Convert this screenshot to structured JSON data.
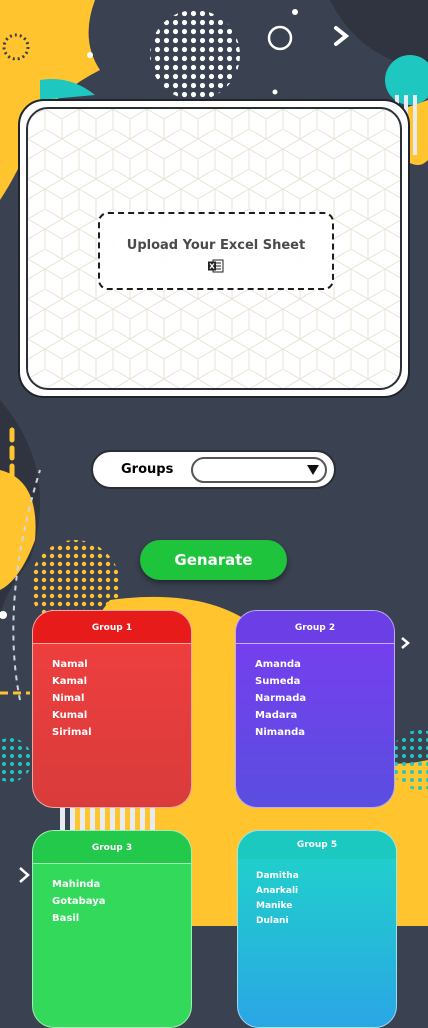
{
  "upload": {
    "label": "Upload Your Excel Sheet",
    "icon": "excel-icon"
  },
  "groups_selector": {
    "label": "Groups",
    "selected": ""
  },
  "generate_button": {
    "label": "Genarate"
  },
  "group_cards": [
    {
      "title": "Group 1",
      "members": [
        "Namal",
        "Kamal",
        "Nimal",
        "Kumal",
        "Sirimal"
      ],
      "color": "#e81b1b"
    },
    {
      "title": "Group 2",
      "members": [
        "Amanda",
        "Sumeda",
        "Narmada",
        "Madara",
        "Nimanda"
      ],
      "color": "#6b3ee6"
    },
    {
      "title": "Group 3",
      "members": [
        "Mahinda",
        "Gotabaya",
        "Basil"
      ],
      "color": "#22c94a"
    },
    {
      "title": "Group 5",
      "members": [
        "Damitha",
        "Anarkali",
        "Manike",
        "Dulani"
      ],
      "color": "#1cc9c0"
    }
  ],
  "colors": {
    "background": "#3a4150",
    "accent_yellow": "#ffc42e",
    "accent_teal": "#1ec8c0",
    "generate_green": "#1ec43b"
  }
}
